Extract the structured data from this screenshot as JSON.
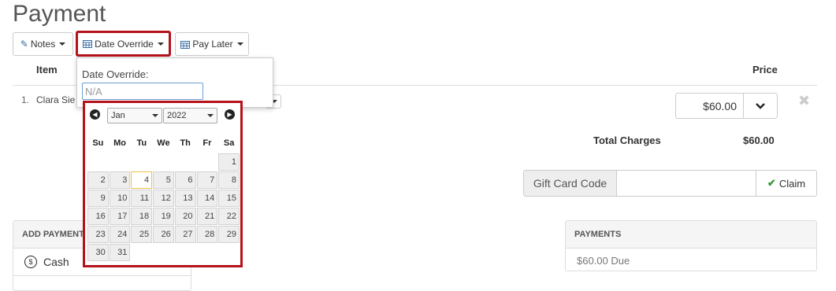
{
  "page": {
    "title": "Payment"
  },
  "toolbar": {
    "notes_label": "Notes",
    "date_override_label": "Date Override",
    "pay_later_label": "Pay Later"
  },
  "table": {
    "item_header": "Item",
    "price_header": "Price",
    "row_number": "1.",
    "row_item": "Clara Sie",
    "row_price": "$60.00",
    "total_label": "Total Charges",
    "total_value": "$60.00"
  },
  "date_override": {
    "label": "Date Override:",
    "input_value": "N/A"
  },
  "calendar": {
    "month": "Jan",
    "year": "2022",
    "weekdays": [
      "Su",
      "Mo",
      "Tu",
      "We",
      "Th",
      "Fr",
      "Sa"
    ],
    "weeks": [
      [
        "",
        "",
        "",
        "",
        "",
        "",
        "1"
      ],
      [
        "2",
        "3",
        "4",
        "5",
        "6",
        "7",
        "8"
      ],
      [
        "9",
        "10",
        "11",
        "12",
        "13",
        "14",
        "15"
      ],
      [
        "16",
        "17",
        "18",
        "19",
        "20",
        "21",
        "22"
      ],
      [
        "23",
        "24",
        "25",
        "26",
        "27",
        "28",
        "29"
      ],
      [
        "30",
        "31",
        "",
        "",
        "",
        "",
        ""
      ]
    ],
    "highlighted_day": "4"
  },
  "gift_card": {
    "label": "Gift Card Code",
    "value": "",
    "claim_label": "Claim"
  },
  "add_payment": {
    "header": "ADD PAYMENT",
    "method": "Cash"
  },
  "payments": {
    "header": "PAYMENTS",
    "due_text": "$60.00 Due"
  },
  "colors": {
    "highlight_border": "#b5121b",
    "claim_check": "#3c9a3c"
  }
}
